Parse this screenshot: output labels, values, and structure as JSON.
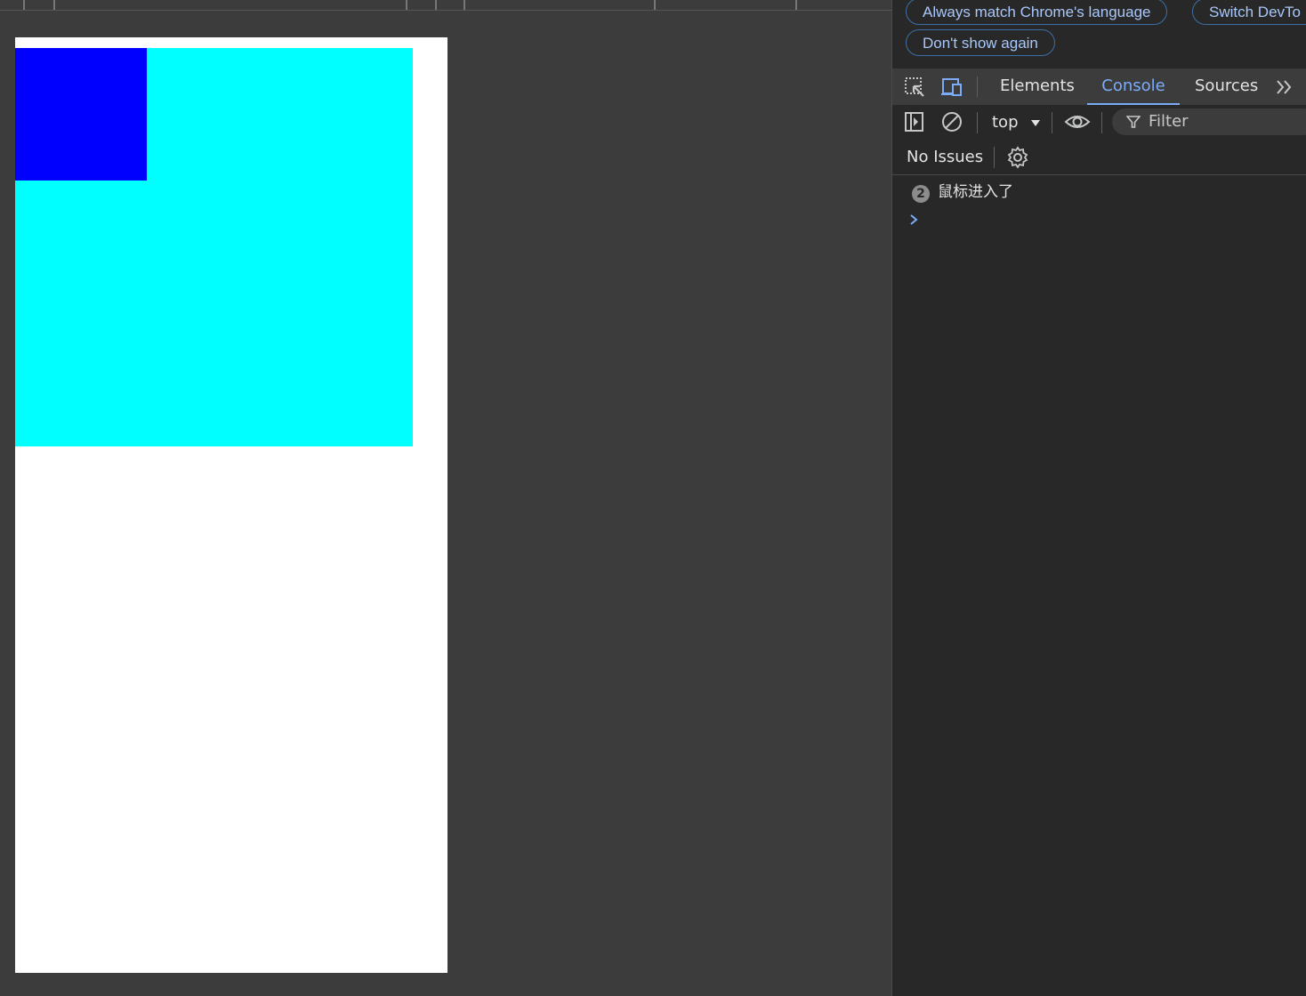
{
  "infobar": {
    "match_language_label": "Always match Chrome's language",
    "switch_label": "Switch DevTo",
    "dont_show_label": "Don't show again"
  },
  "tabs": [
    {
      "label": "Elements",
      "active": false
    },
    {
      "label": "Console",
      "active": true
    },
    {
      "label": "Sources",
      "active": false
    }
  ],
  "toolbar": {
    "context": "top",
    "filter_placeholder": "Filter"
  },
  "issues": {
    "label": "No Issues"
  },
  "console": {
    "messages": [
      {
        "count": "2",
        "text": "鼠标进入了"
      }
    ]
  },
  "colors": {
    "page_bg": "#ffffff",
    "cyan_box": "#00ffff",
    "blue_box": "#0000ff",
    "accent": "#7cacf8"
  },
  "icons": [
    "inspect-element-icon",
    "device-toolbar-icon",
    "more-tabs-icon",
    "sidebar-toggle-icon",
    "clear-console-icon",
    "context-dropdown-icon",
    "live-expression-icon",
    "filter-icon",
    "settings-gear-icon",
    "console-prompt-icon"
  ]
}
